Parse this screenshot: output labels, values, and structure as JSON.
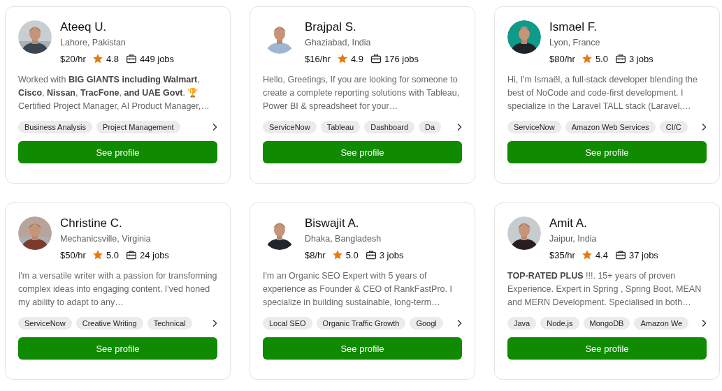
{
  "freelancers": [
    {
      "name": "Ateeq U.",
      "location": "Lahore, Pakistan",
      "rate": "$20/hr",
      "rating": "4.8",
      "jobs": "449 jobs",
      "bio": "Worked with **BIG GIANTS including Walmart**, **Cisco**, **Nissan**, **TracFone**, **and UAE Govt**. 🏆 Certified Project Manager, AI Product Manager,…",
      "skills": [
        "Business Analysis",
        "Project Management"
      ],
      "button": "See profile"
    },
    {
      "name": "Brajpal S.",
      "location": "Ghaziabad, India",
      "rate": "$16/hr",
      "rating": "4.9",
      "jobs": "176 jobs",
      "bio": "Hello, Greetings, If you are looking for someone to create a complete reporting solutions with Tableau, Power BI & spreadsheet for your…",
      "skills": [
        "ServiceNow",
        "Tableau",
        "Dashboard",
        "Da"
      ],
      "button": "See profile"
    },
    {
      "name": "Ismael F.",
      "location": "Lyon, France",
      "rate": "$80/hr",
      "rating": "5.0",
      "jobs": "3 jobs",
      "bio": "Hi, I'm Ismaël, a full-stack developer blending the best of NoCode and code-first development. I specialize in the Laravel TALL stack (Laravel,…",
      "skills": [
        "ServiceNow",
        "Amazon Web Services",
        "CI/C"
      ],
      "button": "See profile"
    },
    {
      "name": "Christine C.",
      "location": "Mechanicsville, Virginia",
      "rate": "$50/hr",
      "rating": "5.0",
      "jobs": "24 jobs",
      "bio": "I'm a versatile writer with a passion for transforming complex ideas into engaging content. I'ved honed my ability to adapt to any…",
      "skills": [
        "ServiceNow",
        "Creative Writing",
        "Technical"
      ],
      "button": "See profile"
    },
    {
      "name": "Biswajit A.",
      "location": "Dhaka, Bangladesh",
      "rate": "$8/hr",
      "rating": "5.0",
      "jobs": "3 jobs",
      "bio": "I'm an Organic SEO Expert with 5 years of experience as Founder & CEO of RankFastPro. I specialize in building sustainable, long-term…",
      "skills": [
        "Local SEO",
        "Organic Traffic Growth",
        "Googl"
      ],
      "button": "See profile"
    },
    {
      "name": "Amit A.",
      "location": "Jaipur, India",
      "rate": "$35/hr",
      "rating": "4.4",
      "jobs": "37 jobs",
      "bio": "**TOP-RATED PLUS** !!!. 15+ years of proven Experience. Expert in Spring , Spring Boot, MEAN and MERN Development. Specialised in both…",
      "skills": [
        "Java",
        "Node.js",
        "MongoDB",
        "Amazon We"
      ],
      "button": "See profile"
    }
  ]
}
